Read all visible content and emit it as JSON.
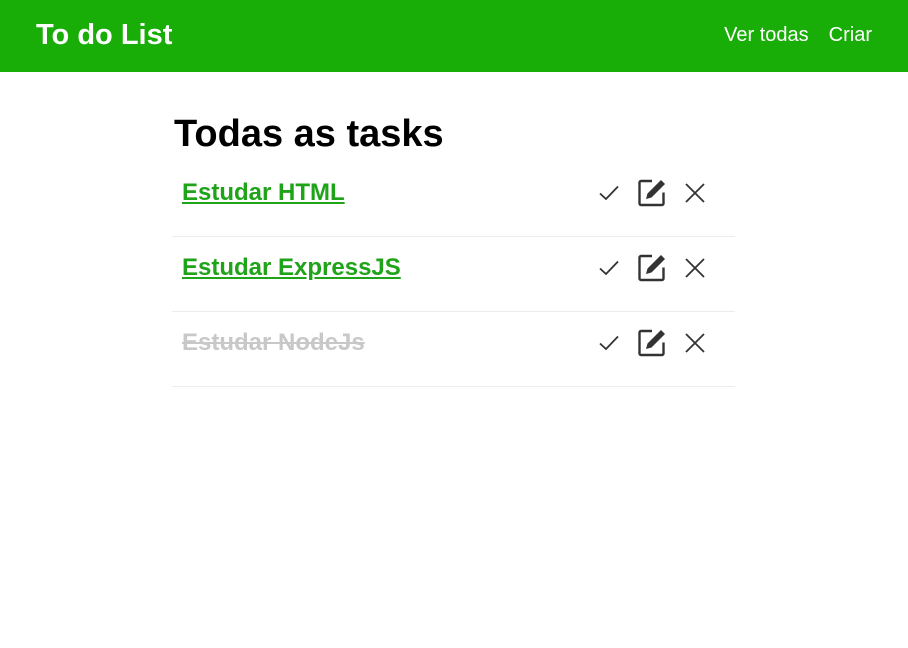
{
  "navbar": {
    "brand": "To do List",
    "links": [
      {
        "label": "Ver todas"
      },
      {
        "label": "Criar"
      }
    ],
    "background_color": "#19ad08"
  },
  "main": {
    "title": "Todas as tasks",
    "tasks": [
      {
        "title": "Estudar HTML",
        "completed": false
      },
      {
        "title": "Estudar ExpressJS",
        "completed": false
      },
      {
        "title": "Estudar NodeJs",
        "completed": true
      }
    ],
    "actions": [
      {
        "icon": "check-icon"
      },
      {
        "icon": "edit-icon"
      },
      {
        "icon": "close-icon"
      }
    ],
    "link_color": "#1fa318",
    "completed_color": "#c8c8c8"
  }
}
